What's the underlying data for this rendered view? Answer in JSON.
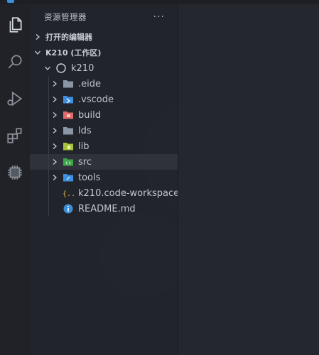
{
  "colors": {
    "background": "#23252c",
    "sidebar": "#22242b",
    "activitybar": "#202228",
    "selection": "#2f323b",
    "accent_blue": "#3a8fdb",
    "folder_gray": "#8b96a4",
    "folder_red": "#e06a6a",
    "folder_green": "#3fa54a",
    "folder_lime": "#a8c23a",
    "folder_vscode": "#3f8fe0",
    "json_yellow": "#e7c04e"
  },
  "activity_bar": {
    "icons": [
      "files-icon",
      "search-icon",
      "run-debug-icon",
      "extensions-icon",
      "chip-icon"
    ]
  },
  "sidebar": {
    "title": "资源管理器",
    "more": "···",
    "open_editors": "打开的编辑器",
    "workspace": "K210 (工作区)",
    "root_folder": "k210",
    "items": [
      {
        "label": ".eide",
        "icon": "folder-icon"
      },
      {
        "label": ".vscode",
        "icon": "vscode-folder-icon"
      },
      {
        "label": "build",
        "icon": "build-folder-icon"
      },
      {
        "label": "lds",
        "icon": "folder-icon"
      },
      {
        "label": "lib",
        "icon": "lib-folder-icon"
      },
      {
        "label": "src",
        "icon": "src-folder-icon"
      },
      {
        "label": "tools",
        "icon": "tools-folder-icon"
      },
      {
        "label": "k210.code-workspace",
        "icon": "json-file-icon"
      },
      {
        "label": "README.md",
        "icon": "info-file-icon"
      }
    ]
  }
}
